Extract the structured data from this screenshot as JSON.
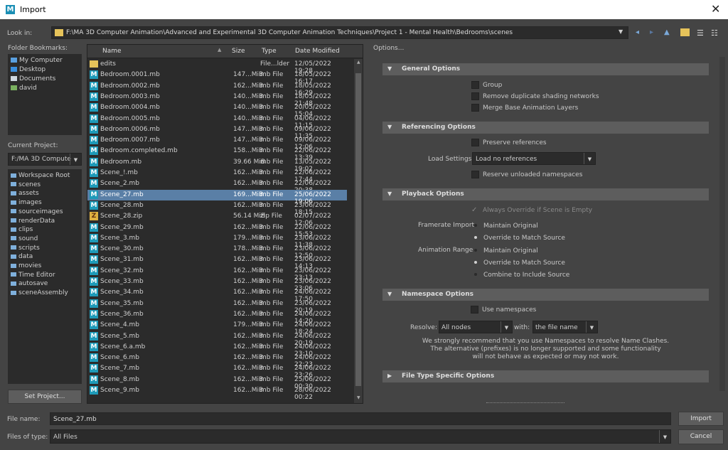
{
  "window": {
    "title": "Import",
    "close": "✕"
  },
  "look_in": {
    "label": "Look in:",
    "path": "F:\\MA 3D Computer Animation\\Advanced and Experimental 3D Computer Animation Techniques\\Project 1 - Mental Health\\Bedrooms\\scenes"
  },
  "bookmarks": {
    "label": "Folder Bookmarks:",
    "items": [
      "My Computer",
      "Desktop",
      "Documents",
      "david"
    ]
  },
  "project": {
    "label": "Current Project:",
    "value": "F:/MA 3D Compute",
    "dirs": [
      "Workspace Root",
      "scenes",
      "assets",
      "images",
      "sourceimages",
      "renderData",
      "clips",
      "sound",
      "scripts",
      "data",
      "movies",
      "Time Editor",
      "autosave",
      "sceneAssembly"
    ],
    "set_button": "Set Project..."
  },
  "table": {
    "headers": [
      "Name",
      "Size",
      "Type",
      "Date Modified"
    ],
    "rows": [
      {
        "icon": "folder",
        "name": "edits",
        "size": "",
        "type": "File...lder",
        "date": "12/05/2022 19:28"
      },
      {
        "icon": "mb",
        "name": "Bedroom.0001.mb",
        "size": "147...MiB",
        "type": "mb File",
        "date": "18/05/2022 16:17"
      },
      {
        "icon": "mb",
        "name": "Bedroom.0002.mb",
        "size": "162...MiB",
        "type": "mb File",
        "date": "18/05/2022 16:29"
      },
      {
        "icon": "mb",
        "name": "Bedroom.0003.mb",
        "size": "140...MiB",
        "type": "mb File",
        "date": "18/05/2022 21:48"
      },
      {
        "icon": "mb",
        "name": "Bedroom.0004.mb",
        "size": "140...MiB",
        "type": "mb File",
        "date": "20/05/2022 15:04"
      },
      {
        "icon": "mb",
        "name": "Bedroom.0005.mb",
        "size": "140...MiB",
        "type": "mb File",
        "date": "04/06/2022 11:15"
      },
      {
        "icon": "mb",
        "name": "Bedroom.0006.mb",
        "size": "147...MiB",
        "type": "mb File",
        "date": "09/06/2022 11:35"
      },
      {
        "icon": "mb",
        "name": "Bedroom.0007.mb",
        "size": "147...MiB",
        "type": "mb File",
        "date": "09/06/2022 12:06"
      },
      {
        "icon": "mb",
        "name": "Bedroom.completed.mb",
        "size": "158...MiB",
        "type": "mb File",
        "date": "22/06/2022 13:39"
      },
      {
        "icon": "mb",
        "name": "Bedroom.mb",
        "size": "39.66 MiB",
        "type": "mb File",
        "date": "13/05/2022 19:02"
      },
      {
        "icon": "mb",
        "name": "Scene_!.mb",
        "size": "162...MiB",
        "type": "mb File",
        "date": "22/06/2022 17:44"
      },
      {
        "icon": "mb",
        "name": "Scene_2.mb",
        "size": "162...MiB",
        "type": "mb File",
        "date": "22/06/2022 20:38"
      },
      {
        "icon": "mb",
        "name": "Scene_27.mb",
        "size": "169...MiB",
        "type": "mb File",
        "date": "25/06/2022 19:06",
        "selected": true
      },
      {
        "icon": "mb",
        "name": "Scene_28.mb",
        "size": "162...MiB",
        "type": "mb File",
        "date": "23/06/2022 18:15"
      },
      {
        "icon": "zip",
        "name": "Scene_28.zip",
        "size": "56.14 MiB",
        "type": "zip File",
        "date": "02/07/2022 12:06"
      },
      {
        "icon": "mb",
        "name": "Scene_29.mb",
        "size": "162...MiB",
        "type": "mb File",
        "date": "22/06/2022 15:53"
      },
      {
        "icon": "mb",
        "name": "Scene_3.mb",
        "size": "179...MiB",
        "type": "mb File",
        "date": "23/06/2022 11:38"
      },
      {
        "icon": "mb",
        "name": "Scene_30.mb",
        "size": "178...MiB",
        "type": "mb File",
        "date": "23/06/2022 12:50"
      },
      {
        "icon": "mb",
        "name": "Scene_31.mb",
        "size": "162...MiB",
        "type": "mb File",
        "date": "23/06/2022 14:13"
      },
      {
        "icon": "mb",
        "name": "Scene_32.mb",
        "size": "162...MiB",
        "type": "mb File",
        "date": "23/06/2022 23:13"
      },
      {
        "icon": "mb",
        "name": "Scene_33.mb",
        "size": "162...MiB",
        "type": "mb File",
        "date": "23/06/2022 23:06"
      },
      {
        "icon": "mb",
        "name": "Scene_34.mb",
        "size": "162...MiB",
        "type": "mb File",
        "date": "24/06/2022 17:50"
      },
      {
        "icon": "mb",
        "name": "Scene_35.mb",
        "size": "162...MiB",
        "type": "mb File",
        "date": "23/06/2022 20:19"
      },
      {
        "icon": "mb",
        "name": "Scene_36.mb",
        "size": "162...MiB",
        "type": "mb File",
        "date": "24/06/2022 14:20"
      },
      {
        "icon": "mb",
        "name": "Scene_4.mb",
        "size": "179...MiB",
        "type": "mb File",
        "date": "24/06/2022 18:24"
      },
      {
        "icon": "mb",
        "name": "Scene_5.mb",
        "size": "162...MiB",
        "type": "mb File",
        "date": "24/06/2022 20:19"
      },
      {
        "icon": "mb",
        "name": "Scene_6.a.mb",
        "size": "162...MiB",
        "type": "mb File",
        "date": "24/06/2022 23:10"
      },
      {
        "icon": "mb",
        "name": "Scene_6.mb",
        "size": "162...MiB",
        "type": "mb File",
        "date": "24/06/2022 22:23"
      },
      {
        "icon": "mb",
        "name": "Scene_7.mb",
        "size": "162...MiB",
        "type": "mb File",
        "date": "24/06/2022 23:26"
      },
      {
        "icon": "mb",
        "name": "Scene_8.mb",
        "size": "162...MiB",
        "type": "mb File",
        "date": "25/06/2022 00:30"
      },
      {
        "icon": "mb",
        "name": "Scene_9.mb",
        "size": "162...MiB",
        "type": "mb File",
        "date": "28/06/2022 00:22"
      }
    ]
  },
  "options": {
    "label": "Options...",
    "general": {
      "title": "General Options",
      "group": "Group",
      "remove_dup": "Remove duplicate shading networks",
      "merge": "Merge Base Animation Layers"
    },
    "referencing": {
      "title": "Referencing Options",
      "preserve": "Preserve references",
      "load_label": "Load Settings",
      "load_value": "Load no references",
      "reserve": "Reserve unloaded namespaces"
    },
    "playback": {
      "title": "Playback Options",
      "always": "Always Override if Scene is Empty",
      "fr_label": "Framerate Import",
      "fr_opt1": "Maintain Original",
      "fr_opt2": "Override to Match Source",
      "ar_label": "Animation Range",
      "ar_opt1": "Maintain Original",
      "ar_opt2": "Override to Match Source",
      "ar_opt3": "Combine to Include Source"
    },
    "namespace": {
      "title": "Namespace Options",
      "use": "Use namespaces",
      "resolve_label": "Resolve:",
      "resolve_value": "All nodes",
      "with_label": "with:",
      "with_value": "the file name",
      "note1": "We strongly recommend that you use Namespaces to resolve Name Clashes.",
      "note2": "The alternative (prefixes) is no longer supported and some functionality",
      "note3": "will not behave as expected or may not work."
    },
    "filetype": {
      "title": "File Type Specific Options"
    }
  },
  "bottom": {
    "filename_label": "File name:",
    "filename": "Scene_27.mb",
    "filetype_label": "Files of type:",
    "filetype": "All Files",
    "import": "Import",
    "cancel": "Cancel"
  }
}
